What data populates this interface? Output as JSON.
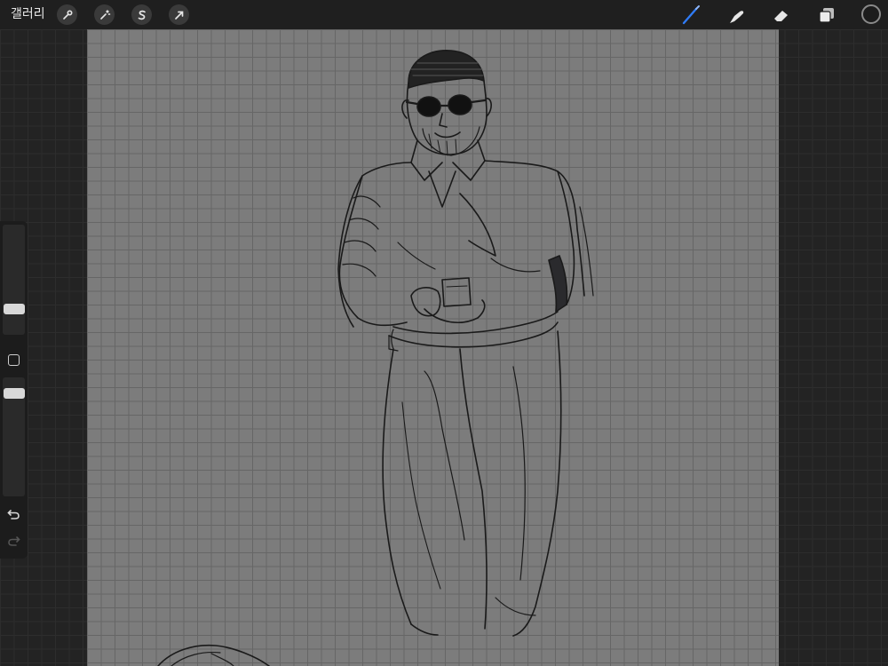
{
  "topbar": {
    "gallery_label": "갤러리",
    "left_tools": [
      {
        "name": "actions",
        "icon": "wrench-icon"
      },
      {
        "name": "adjustments",
        "icon": "magic-wand-icon"
      },
      {
        "name": "selection",
        "icon": "selection-s-icon"
      },
      {
        "name": "transform",
        "icon": "arrow-cursor-icon"
      }
    ],
    "right_tools": [
      {
        "name": "brush",
        "icon": "brush-icon",
        "active": true
      },
      {
        "name": "smudge",
        "icon": "smudge-icon",
        "active": false
      },
      {
        "name": "eraser",
        "icon": "eraser-icon",
        "active": false
      },
      {
        "name": "layers",
        "icon": "layers-icon",
        "active": false
      }
    ],
    "current_color": "#1c1c1c",
    "accent_color": "#2f7bf5"
  },
  "sidebar": {
    "brush_size_level": 0.3,
    "opacity_level": 0.8,
    "undo_icon": "undo-icon",
    "redo_icon": "redo-icon"
  },
  "canvas": {
    "background": "#7c7c7c",
    "grid": true
  }
}
